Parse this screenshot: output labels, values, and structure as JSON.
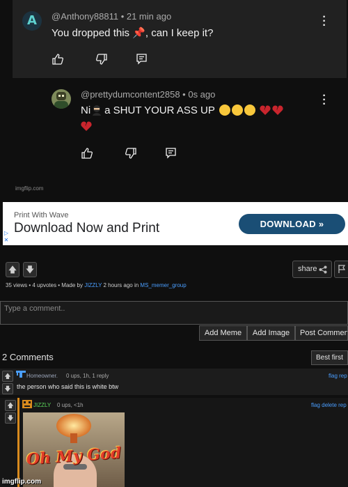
{
  "meme": {
    "comment1": {
      "username": "@Anthony88811 • 21 min ago",
      "text": "You dropped this 📌, can I keep it?"
    },
    "comment2": {
      "username": "@prettydumcontent2858 • 0s ago",
      "line1_before": "Ni",
      "line1_after": "a SHUT YOUR ASS UP",
      "emoji_colors": {
        "cry": "#f8c73b",
        "heart": "#c9252d"
      }
    },
    "watermark": "imgflip.com"
  },
  "ad": {
    "small_text": "Print With Wave",
    "headline": "Download Now and Print",
    "button_label": "DOWNLOAD »",
    "button_color": "#1a4e75"
  },
  "post": {
    "share_label": "share",
    "meta": {
      "stats": "35 views • 4 upvotes • Made by ",
      "author": "JIZZLY",
      "time": " 2 hours ago in ",
      "stream": "MS_memer_group"
    },
    "comment_placeholder": "Type a comment..",
    "buttons": {
      "add_meme": "Add Meme",
      "add_image": "Add Image",
      "post_comment": "Post Comment"
    }
  },
  "comments": {
    "count_label": "2 Comments",
    "sort_label": "Best first",
    "items": [
      {
        "username": "Homeowner.",
        "stats": "0 ups, 1h, 1 reply",
        "links": "flag  rep",
        "body": "the person who said this is white btw",
        "name_color": "#9aa4b8"
      },
      {
        "username": "JIZZLY",
        "stats": "0 ups, <1h",
        "links": "flag  delete  rep",
        "name_color": "#5cd65c",
        "image_caption": "Oh My God"
      }
    ]
  },
  "footer": {
    "watermark": "imgflip.com"
  },
  "colors": {
    "link": "#4a9eff",
    "bg": "#0f0f0f",
    "card": "#212121"
  }
}
